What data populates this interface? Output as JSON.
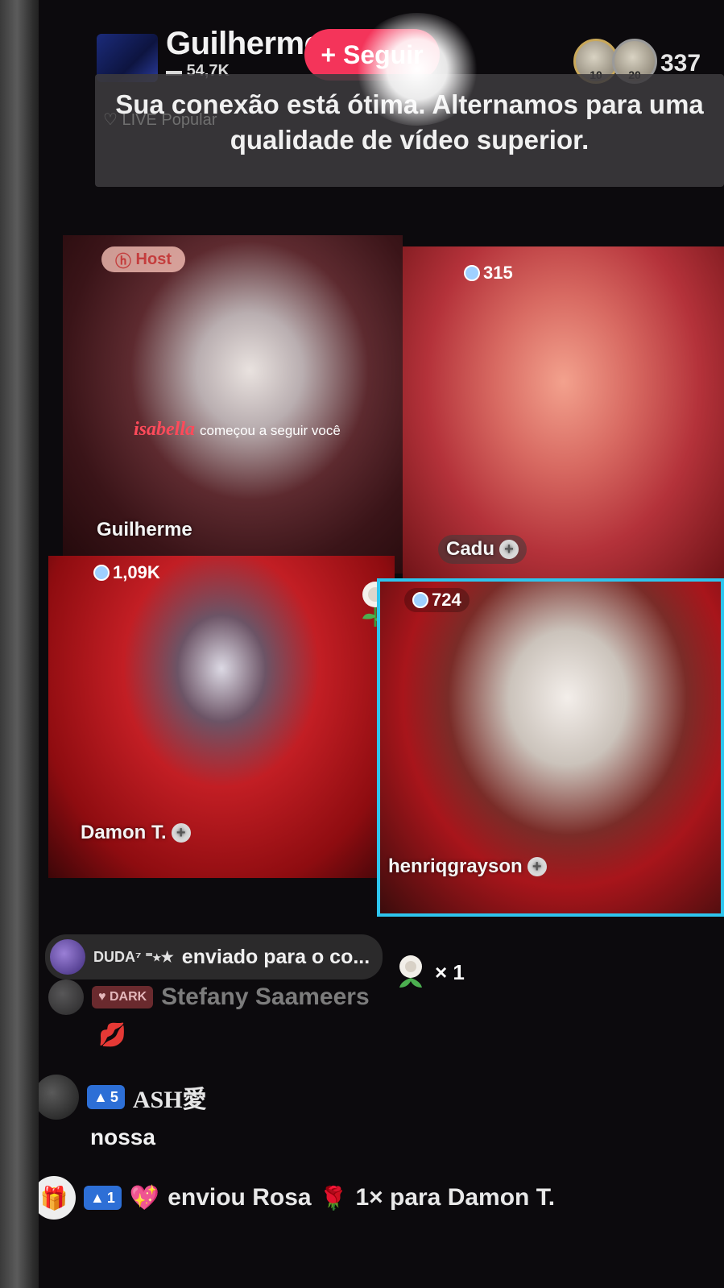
{
  "header": {
    "host_name": "Guilherme",
    "host_likes": "54,7K",
    "follow_label": "+ Seguir",
    "viewer_avatars": [
      {
        "badge": "10"
      },
      {
        "badge": "20"
      }
    ],
    "viewer_count": "337"
  },
  "toast": {
    "background_label": "LIVE Popular",
    "message": "Sua conexão está ótima. Alternamos para uma qualidade de vídeo superior."
  },
  "tiles": [
    {
      "name": "Guilherme",
      "badge": "Host",
      "follow_notice": {
        "user": "isabella",
        "text": "começou a seguir você"
      }
    },
    {
      "name": "Cadu",
      "count": "315"
    },
    {
      "name": "Damon T.",
      "count": "1,09K"
    },
    {
      "name": "henriqgrayson",
      "count": "724",
      "active_color": "#2ec5ee"
    }
  ],
  "chat": {
    "gift_message": {
      "sender": "DUDA⁷ ⁼⭑★",
      "text": "enviado para o co...",
      "multiplier": "× 1"
    },
    "comments": [
      {
        "badge": "DARK",
        "user": "Stefany Saameers",
        "text": "💋"
      },
      {
        "level": "5",
        "user": "ASH愛",
        "text": "nossa"
      }
    ],
    "gift_event": {
      "level": "1",
      "text": "enviou Rosa",
      "suffix": "1× para Damon T."
    }
  },
  "colors": {
    "follow_button": "#f4345a",
    "active_tile_border": "#2ec5ee",
    "level_badge": "#2d6fd6"
  }
}
